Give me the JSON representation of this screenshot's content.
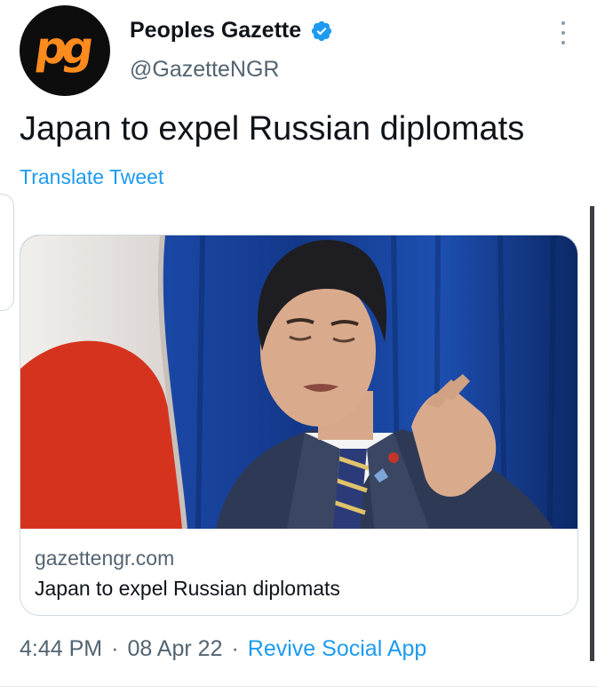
{
  "account": {
    "avatar_text": "pg",
    "display_name": "Peoples Gazette",
    "handle": "@GazetteNGR",
    "verified": true
  },
  "tweet": {
    "text": "Japan to expel Russian diplomats",
    "translate_label": "Translate Tweet"
  },
  "link_card": {
    "domain": "gazettengr.com",
    "title": "Japan to expel Russian diplomats"
  },
  "meta": {
    "time": "4:44 PM",
    "separator": "·",
    "date": "08 Apr 22",
    "source": "Revive Social App"
  },
  "colors": {
    "accent": "#1d9bf0",
    "avatar_bg": "#0d0d0d",
    "avatar_fg": "#ff8a1e",
    "secondary_text": "#536471"
  },
  "icons": {
    "verified": "verified-badge-icon",
    "more": "more-options-icon"
  }
}
